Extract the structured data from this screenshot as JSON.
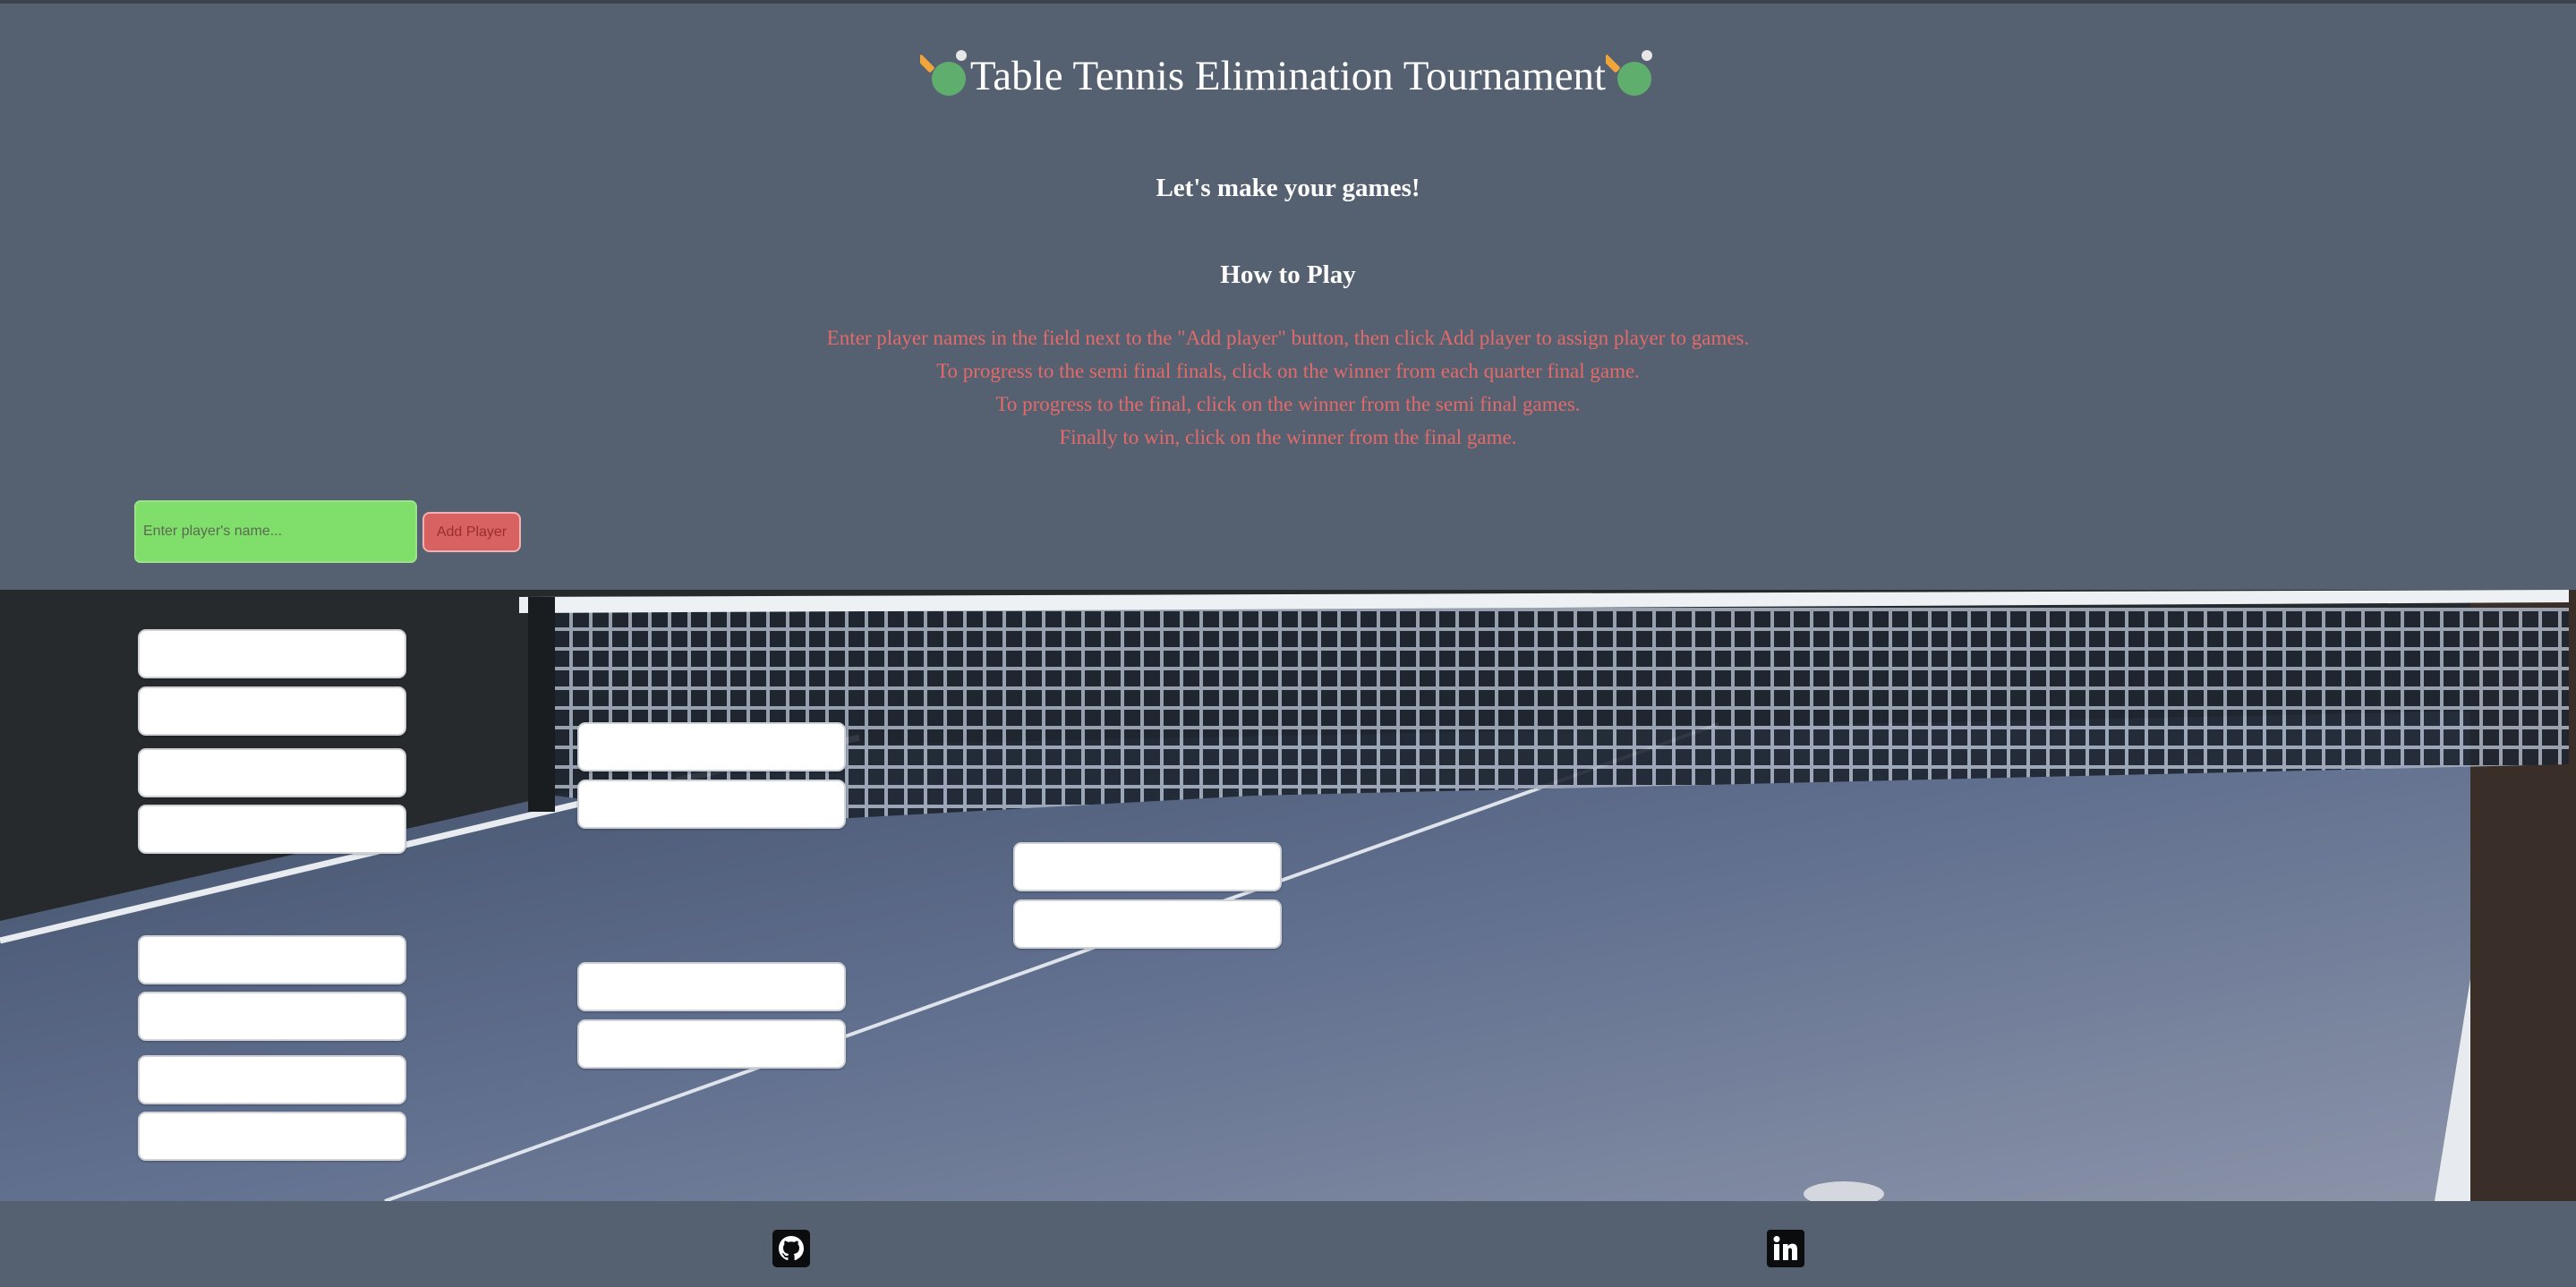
{
  "header": {
    "title": "Table Tennis Elimination Tournament",
    "subtitle": "Let's make your games!",
    "howto_title": "How to Play",
    "instructions": [
      "Enter player names in the field next to the \"Add player\" button, then click Add player to assign player to games.",
      "To progress to the semi final finals, click on the winner from each quarter final game.",
      "To progress to the final, click on the winner from the semi final games.",
      "Finally to win, click on the winner from the final game."
    ]
  },
  "add_player": {
    "placeholder": "Enter player's name...",
    "button_label": "Add Player"
  },
  "bracket": {
    "quarter_finals": [
      "",
      "",
      "",
      "",
      "",
      "",
      "",
      ""
    ],
    "semi_finals": [
      "",
      "",
      "",
      ""
    ],
    "final": [
      "",
      ""
    ]
  },
  "footer": {
    "icons": [
      "github-icon",
      "linkedin-icon"
    ]
  },
  "colors": {
    "background": "#556170",
    "instruction_text": "#e46a6a",
    "input_bg": "#80de6a",
    "button_bg": "#d86262",
    "court_blue": "#5f7091"
  }
}
